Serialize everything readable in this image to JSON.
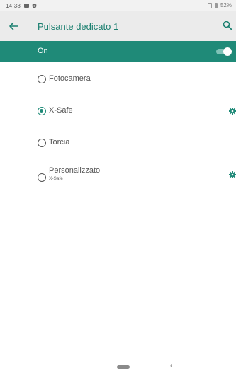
{
  "status_bar": {
    "time": "14:38",
    "battery": "52%",
    "icons": [
      "image-icon",
      "shield-icon",
      "no-sim-icon",
      "battery-icon"
    ]
  },
  "app_bar": {
    "title": "Pulsante dedicato 1",
    "back_icon": "arrow-left-icon",
    "search_icon": "search-icon",
    "title_color": "#1a7f6f"
  },
  "toggle": {
    "label": "On",
    "state": "on",
    "bar_color": "#1f8a78"
  },
  "options": [
    {
      "label": "Fotocamera",
      "selected": false,
      "has_settings": false
    },
    {
      "label": "X-Safe",
      "selected": true,
      "has_settings": true
    },
    {
      "label": "Torcia",
      "selected": false,
      "has_settings": false
    },
    {
      "label": "Personalizzato",
      "sublabel": "X-Safe",
      "selected": false,
      "has_settings": true
    }
  ],
  "nav_bar": {
    "back_glyph": "‹",
    "icons": [
      "home-pill-icon",
      "back-chevron-icon"
    ]
  }
}
